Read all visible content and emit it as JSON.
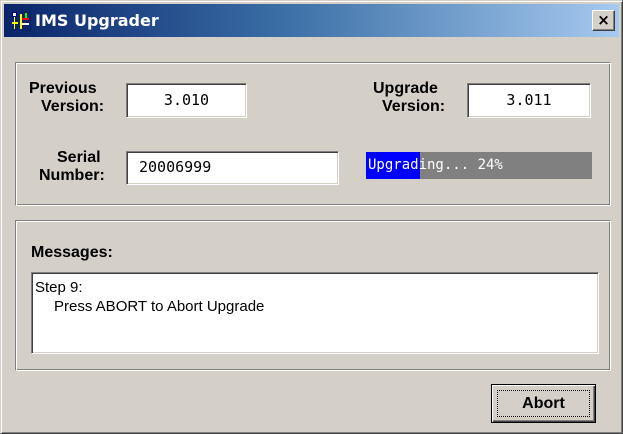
{
  "window": {
    "title": "IMS Upgrader",
    "close_label": "×"
  },
  "versions": {
    "previous_label_line1": "Previous",
    "previous_label_line2": "Version:",
    "previous_value": "3.010",
    "upgrade_label_line1": "Upgrade",
    "upgrade_label_line2": "Version:",
    "upgrade_value": "3.011"
  },
  "serial": {
    "label_line1": "Serial",
    "label_line2": "Number:",
    "value": "20006999"
  },
  "progress": {
    "text": "Upgrading... 24%",
    "percent": 24,
    "fill_color": "#0000ff",
    "track_color": "#808080"
  },
  "messages": {
    "label": "Messages:",
    "lines": [
      "Step 9:",
      "Press ABORT to Abort Upgrade"
    ]
  },
  "buttons": {
    "abort_label": "Abort"
  }
}
